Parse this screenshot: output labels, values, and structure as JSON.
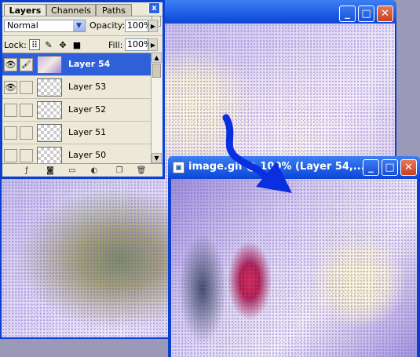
{
  "layers_panel": {
    "tabs": [
      "Layers",
      "Channels",
      "Paths"
    ],
    "close_label": "x",
    "menu_label": "▶",
    "blend_mode": "Normal",
    "opacity_label": "Opacity:",
    "opacity_value": "100%",
    "lock_label": "Lock:",
    "fill_label": "Fill:",
    "fill_value": "100%",
    "layers": [
      {
        "name": "Layer 54",
        "visible": true,
        "selected": true
      },
      {
        "name": "Layer 53",
        "visible": true,
        "selected": false
      },
      {
        "name": "Layer 52",
        "visible": false,
        "selected": false
      },
      {
        "name": "Layer 51",
        "visible": false,
        "selected": false
      },
      {
        "name": "Layer 50",
        "visible": false,
        "selected": false
      }
    ]
  },
  "front_window": {
    "title": "image.gif @ 100% (Layer 54,..."
  },
  "window_buttons": {
    "minimize": "_",
    "maximize": "□",
    "close": "✕"
  },
  "colors": {
    "titlebar": "#0a46d6",
    "selected_layer": "#2f5fd9",
    "arrow": "#0a2fe0"
  }
}
